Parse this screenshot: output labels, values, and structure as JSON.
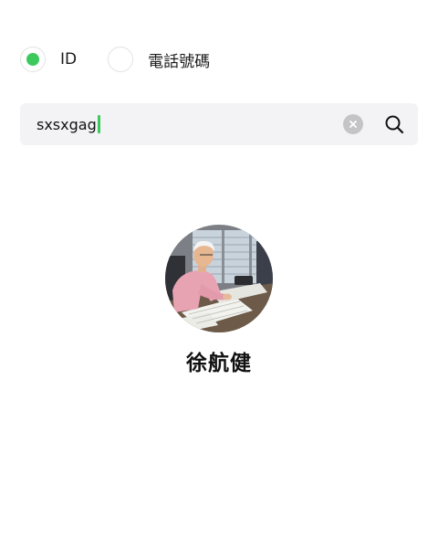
{
  "search_type": {
    "options": [
      {
        "label": "ID",
        "selected": true
      },
      {
        "label": "電話號碼",
        "selected": false
      }
    ]
  },
  "search": {
    "query": "sxsxgag",
    "clear_icon": "clear-circle-icon",
    "search_icon": "magnifier-icon"
  },
  "result": {
    "name": "徐航健",
    "avatar": "photo of an elderly man in a pink shirt writing at a desk covered with papers"
  },
  "colors": {
    "accent": "#3ec95f",
    "search_box_bg": "#f3f3f5",
    "clear_button_bg": "#c4c4c6",
    "text": "#111111"
  }
}
